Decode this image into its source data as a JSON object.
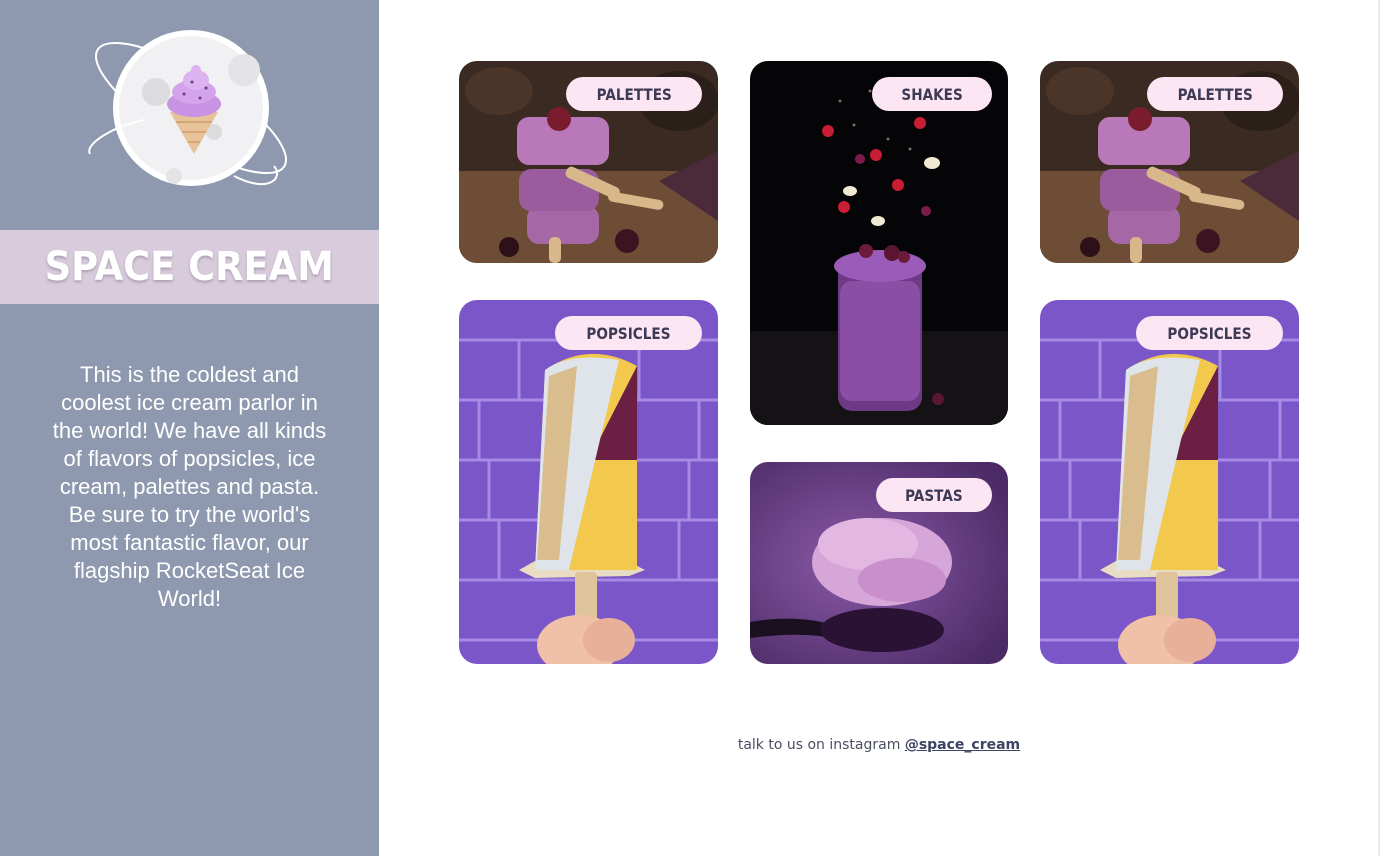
{
  "brand": {
    "title": "SPACE CREAM",
    "logo_icon": "ice-cream-planet-icon"
  },
  "sidebar": {
    "description": "This is the coldest and coolest ice cream parlor in the world! We have all kinds of flavors of popsicles, ice cream, palettes and pasta. Be sure to try the world's most fantastic flavor, our flagship RocketSeat Ice World!",
    "background": "#8e98ae",
    "band_color": "#d8cbdb"
  },
  "gallery": {
    "cards": [
      {
        "tag": "PALETTES"
      },
      {
        "tag": "SHAKES"
      },
      {
        "tag": "PALETTES"
      },
      {
        "tag": "POPSICLES"
      },
      {
        "tag": "PASTAS"
      },
      {
        "tag": "POPSICLES"
      }
    ],
    "tag_color": "#fde6f4"
  },
  "footer": {
    "text": "talk to us on instagram",
    "link_text": "@space_cream"
  }
}
